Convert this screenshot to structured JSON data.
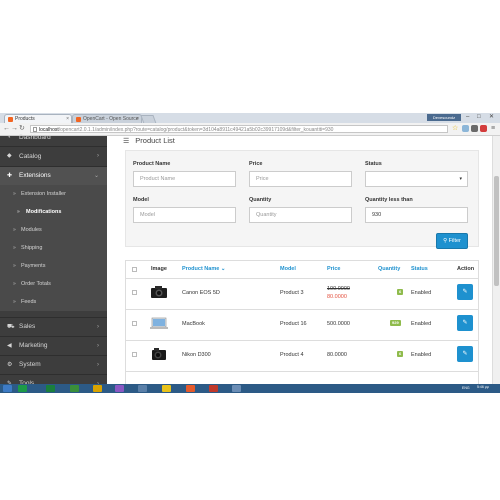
{
  "browser": {
    "tabs": [
      {
        "label": "Products"
      },
      {
        "label": "OpenCart - Open Source"
      }
    ],
    "window_badge": "Devesoundz",
    "url_host": "localhost",
    "url_path": "/opencart2.0.1.1/admin/index.php?route=catalog/product&token=3d104a8911c49421a5b02c39917109d&filter_kouantiti=930"
  },
  "sidebar": {
    "items": [
      {
        "label": "Dashboard",
        "icon": "dashboard-icon"
      },
      {
        "label": "Catalog",
        "icon": "tag-icon"
      },
      {
        "label": "Extensions",
        "icon": "puzzle-icon"
      },
      {
        "label": "Sales",
        "icon": "cart-icon"
      },
      {
        "label": "Marketing",
        "icon": "share-icon"
      },
      {
        "label": "System",
        "icon": "gear-icon"
      },
      {
        "label": "Tools",
        "icon": "wrench-icon"
      }
    ],
    "sub": [
      {
        "label": "Extension Installer"
      },
      {
        "label": "Modifications"
      },
      {
        "label": "Modules"
      },
      {
        "label": "Shipping"
      },
      {
        "label": "Payments"
      },
      {
        "label": "Order Totals"
      },
      {
        "label": "Feeds"
      }
    ]
  },
  "page": {
    "title": "Product List",
    "filter": {
      "product_name_label": "Product Name",
      "product_name_placeholder": "Product Name",
      "price_label": "Price",
      "price_placeholder": "Price",
      "status_label": "Status",
      "status_value": "",
      "model_label": "Model",
      "model_placeholder": "Model",
      "quantity_label": "Quantity",
      "quantity_placeholder": "Quantity",
      "quantity_less_label": "Quantity less than",
      "quantity_less_value": "930",
      "filter_button": "Filter"
    },
    "table": {
      "headers": [
        "Image",
        "Product Name",
        "Model",
        "Price",
        "Quantity",
        "Status",
        "Action"
      ],
      "rows": [
        {
          "name": "Canon EOS 5D",
          "model": "Product 3",
          "price": "100.0000",
          "special": "80.0000",
          "quantity": "6",
          "status": "Enabled"
        },
        {
          "name": "MacBook",
          "model": "Product 16",
          "price": "500.0000",
          "special": "",
          "quantity": "929",
          "status": "Enabled"
        },
        {
          "name": "Nikon D300",
          "model": "Product 4",
          "price": "80.0000",
          "special": "",
          "quantity": "6",
          "status": "Enabled"
        }
      ]
    }
  },
  "taskbar": {
    "time": "5:46 μμ",
    "lang": "ENG"
  },
  "colors": {
    "accent": "#1e91cf",
    "sidebar": "#3d3d3d",
    "quantity_badge": "#8fbb4c",
    "special_price": "#e3503e"
  }
}
